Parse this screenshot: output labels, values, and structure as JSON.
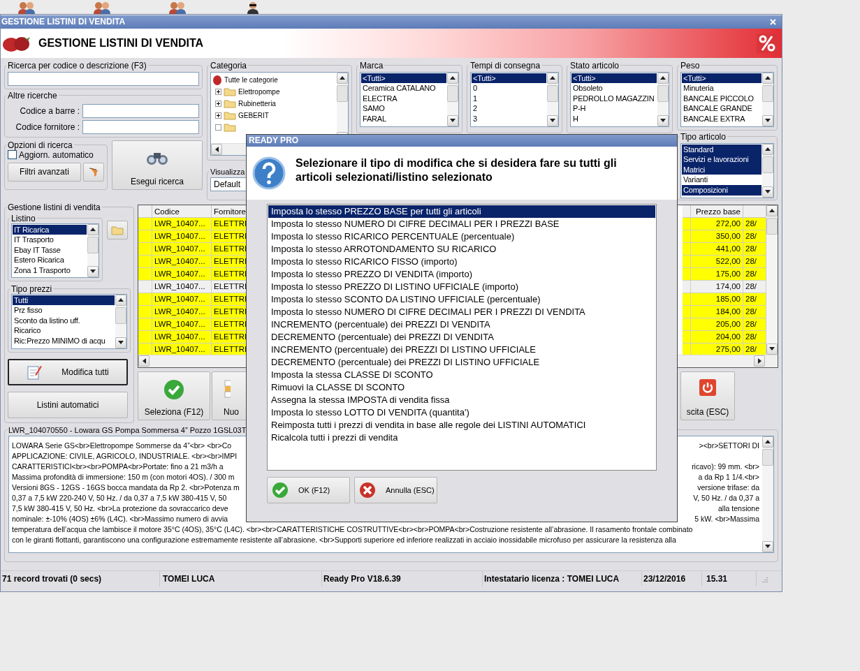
{
  "window": {
    "title": "GESTIONE LISTINI DI VENDITA"
  },
  "header": {
    "title": "GESTIONE LISTINI DI VENDITA"
  },
  "search": {
    "label": "Ricerca per codice o descrizione (F3)"
  },
  "other_searches": {
    "label": "Altre ricerche",
    "fields": [
      {
        "label": "Codice a barre :"
      },
      {
        "label": "Codice fornitore :"
      }
    ]
  },
  "search_options": {
    "label": "Opzioni di ricerca",
    "auto_update": {
      "label": "Aggiorn. automatico",
      "checked": false
    },
    "advanced_filters": "Filtri avanzati"
  },
  "run_search": "Esegui ricerca",
  "category": {
    "label": "Categoria",
    "root": "Tutte le categorie",
    "items": [
      {
        "label": "Elettropompe",
        "expanded": false
      },
      {
        "label": "Rubinetteria",
        "expanded": false
      },
      {
        "label": "GEBERIT",
        "expanded": false
      }
    ]
  },
  "view": {
    "label": "Visualizza",
    "value": "Default"
  },
  "filters": [
    {
      "label": "Marca",
      "items": [
        {
          "label": "<Tutti>",
          "selected": true
        },
        {
          "label": "Ceramica CATALANO",
          "selected": false
        },
        {
          "label": "ELECTRA",
          "selected": false
        },
        {
          "label": "SAMO",
          "selected": false
        },
        {
          "label": "FARAL",
          "selected": false
        }
      ]
    },
    {
      "label": "Tempi di consegna",
      "items": [
        {
          "label": "<Tutti>",
          "selected": true
        },
        {
          "label": "0",
          "selected": false
        },
        {
          "label": "1",
          "selected": false
        },
        {
          "label": "2",
          "selected": false
        },
        {
          "label": "3",
          "selected": false
        }
      ]
    },
    {
      "label": "Stato articolo",
      "items": [
        {
          "label": "<Tutti>",
          "selected": true
        },
        {
          "label": "Obsoleto",
          "selected": false
        },
        {
          "label": "PEDROLLO MAGAZZIN",
          "selected": false
        },
        {
          "label": "P-H",
          "selected": false
        },
        {
          "label": "H",
          "selected": false
        }
      ]
    },
    {
      "label": "Peso",
      "items": [
        {
          "label": "<Tutti>",
          "selected": true
        },
        {
          "label": "Minuteria",
          "selected": false
        },
        {
          "label": "BANCALE PICCOLO",
          "selected": false
        },
        {
          "label": "BANCALE GRANDE",
          "selected": false
        },
        {
          "label": "BANCALE EXTRA",
          "selected": false
        }
      ]
    }
  ],
  "item_type": {
    "label": "Tipo articolo",
    "items": [
      {
        "label": "Standard",
        "selected": true
      },
      {
        "label": "Servizi e lavorazioni",
        "selected": true
      },
      {
        "label": "Matrici",
        "selected": true
      },
      {
        "label": "Varianti",
        "selected": false
      },
      {
        "label": "Composizioni",
        "selected": true
      }
    ]
  },
  "price_lists": {
    "label": "Gestione listini di vendita",
    "list": {
      "label": "Listino",
      "items": [
        {
          "label": "IT Ricarica",
          "selected": true
        },
        {
          "label": "IT Trasporto",
          "selected": false
        },
        {
          "label": "Ebay IT Tasse",
          "selected": false
        },
        {
          "label": "Estero Ricarica",
          "selected": false
        },
        {
          "label": "Zona 1 Trasporto",
          "selected": false
        }
      ]
    },
    "price_type": {
      "label": "Tipo prezzi",
      "items": [
        {
          "label": "Tutti",
          "selected": true
        },
        {
          "label": "Prz fisso",
          "selected": false
        },
        {
          "label": "Sconto da listino uff.",
          "selected": false
        },
        {
          "label": "Ricarico",
          "selected": false
        },
        {
          "label": "Ric:Prezzo MINIMO di acqu",
          "selected": false
        }
      ]
    },
    "buttons": [
      {
        "label": "Modifica tutti",
        "kind": "edit",
        "focused": true
      },
      {
        "label": "Listini automatici",
        "kind": "plain",
        "focused": false
      }
    ]
  },
  "table": {
    "columns": [
      "Codice",
      "Fornitore",
      "Prezzo base"
    ],
    "rows": [
      {
        "code": "LWR_10407...",
        "supplier": "ELETTRI",
        "base_price": "272,00",
        "column_4": "28/",
        "highlight": true
      },
      {
        "code": "LWR_10407...",
        "supplier": "ELETTRI",
        "base_price": "350,00",
        "column_4": "28/",
        "highlight": true
      },
      {
        "code": "LWR_10407...",
        "supplier": "ELETTRI",
        "base_price": "441,00",
        "column_4": "28/",
        "highlight": true
      },
      {
        "code": "LWR_10407...",
        "supplier": "ELETTRI",
        "base_price": "522,00",
        "column_4": "28/",
        "highlight": true
      },
      {
        "code": "LWR_10407...",
        "supplier": "ELETTRI",
        "base_price": "175,00",
        "column_4": "28/",
        "highlight": true
      },
      {
        "code": "LWR_10407...",
        "supplier": "ELETTRI",
        "base_price": "174,00",
        "column_4": "28/",
        "highlight": false
      },
      {
        "code": "LWR_10407...",
        "supplier": "ELETTRI",
        "base_price": "185,00",
        "column_4": "28/",
        "highlight": true
      },
      {
        "code": "LWR_10407...",
        "supplier": "ELETTRI",
        "base_price": "184,00",
        "column_4": "28/",
        "highlight": true
      },
      {
        "code": "LWR_10407...",
        "supplier": "ELETTRI",
        "base_price": "205,00",
        "column_4": "28/",
        "highlight": true
      },
      {
        "code": "LWR_10407...",
        "supplier": "ELETTRI",
        "base_price": "204,00",
        "column_4": "28/",
        "highlight": true
      },
      {
        "code": "LWR_10407...",
        "supplier": "ELETTRI",
        "base_price": "275,00",
        "column_4": "28/",
        "highlight": true
      }
    ]
  },
  "actions": [
    {
      "label": "Seleziona (F12)",
      "kind": "select"
    },
    {
      "label": "Nuo",
      "kind": "new"
    },
    {
      "label": "scita (ESC)",
      "kind": "exit"
    }
  ],
  "description": {
    "title": "LWR_104070550 - Lowara GS Pompa Sommersa 4” Pozzo 1GSL03T",
    "lines": [
      {
        "left": "LOWARA Serie GS<br>Elettropompe Sommerse da 4”<br> <br>Co",
        "right": "><br>SETTORI DI"
      },
      {
        "left": "APPLICAZIONE: CIVILE, AGRICOLO, INDUSTRIALE. <br><br>IMPI"
      },
      {
        "left": "CARATTERISTICI<br><br>POMPA<br>Portate: fino a 21 m3/h a",
        "right": "ricavo): 99 mm. <br>"
      },
      {
        "left": "Massima profondità di immersione: 150 m (con motori 4OS). / 300 m",
        "right": "a da Rp 1 1/4.<br>"
      },
      {
        "left": "Versioni 8GS - 12GS - 16GS bocca mandata da Rp 2. <br>Potenza m",
        "right": "versione trifase: da"
      },
      {
        "left": "0,37 a 7,5 kW 220-240 V, 50 Hz. / da 0,37 a 7,5 kW 380-415 V, 50",
        "right": "V, 50 Hz. / da 0,37 a"
      },
      {
        "left": "7,5 kW 380-415 V, 50 Hz. <br>La protezione da sovraccarico deve",
        "right": "alla tensione"
      },
      {
        "left": "nominale: ±-10% (4OS) ±6% (L4C). <br>Massimo numero di avvia",
        "right": "5 kW. <br>Massima"
      },
      {
        "left": "temperatura dell’acqua che lambisce il motore 35°C (4OS), 35°C (L4C). <br><br>CARATTERISTICHE COSTRUTTIVE<br><br>POMPA<br>Costruzione resistente all’abrasione. Il rasamento frontale combinato"
      },
      {
        "left": "con le giranti flottanti, garantiscono una configurazione estremamente resistente all’abrasione. <br>Supporti superiore ed inferiore realizzati in acciaio inossidabile microfuso per assicurare la resistenza alla"
      }
    ]
  },
  "status_bar": [
    "71 record trovati (0 secs)",
    "TOMEI LUCA",
    "Ready Pro V18.6.39",
    "Intestatario licenza : TOMEI LUCA",
    "23/12/2016",
    "15.31"
  ],
  "dialog": {
    "title": "READY PRO",
    "message": "Selezionare il tipo di modifica che si desidera fare su tutti gli articoli selezionati/listino selezionato",
    "options": [
      {
        "label": "Imposta lo stesso PREZZO BASE per tutti gli articoli",
        "selected": true
      },
      {
        "label": "Imposta lo stesso NUMERO DI CIFRE DECIMALI PER I PREZZI BASE",
        "selected": false
      },
      {
        "label": "Imposta lo stesso RICARICO PERCENTUALE (percentuale)",
        "selected": false
      },
      {
        "label": "Imposta lo stesso ARROTONDAMENTO SU RICARICO",
        "selected": false
      },
      {
        "label": "Imposta lo stesso RICARICO FISSO (importo)",
        "selected": false
      },
      {
        "label": "Imposta lo stesso PREZZO DI VENDITA (importo)",
        "selected": false
      },
      {
        "label": "Imposta lo stesso PREZZO DI LISTINO UFFICIALE (importo)",
        "selected": false
      },
      {
        "label": "Imposta lo stesso SCONTO DA LISTINO UFFICIALE (percentuale)",
        "selected": false
      },
      {
        "label": "Imposta lo stesso NUMERO DI CIFRE DECIMALI PER I PREZZI DI VENDITA",
        "selected": false
      },
      {
        "label": "INCREMENTO (percentuale) dei PREZZI DI VENDITA",
        "selected": false
      },
      {
        "label": "DECREMENTO (percentuale) dei PREZZI DI VENDITA",
        "selected": false
      },
      {
        "label": "INCREMENTO (percentuale) dei PREZZI DI LISTINO UFFICIALE",
        "selected": false
      },
      {
        "label": "DECREMENTO (percentuale) dei PREZZI DI LISTINO UFFICIALE",
        "selected": false
      },
      {
        "label": "Imposta la stessa CLASSE DI SCONTO",
        "selected": false
      },
      {
        "label": "Rimuovi la CLASSE DI SCONTO",
        "selected": false
      },
      {
        "label": "Assegna la stessa IMPOSTA di vendita fissa",
        "selected": false
      },
      {
        "label": "Imposta lo stesso LOTTO DI VENDITA (quantita')",
        "selected": false
      },
      {
        "label": "Reimposta tutti i prezzi di vendita in base alle regole dei LISTINI AUTOMATICI",
        "selected": false
      },
      {
        "label": "Ricalcola tutti i prezzi di vendita",
        "selected": false
      }
    ],
    "buttons": [
      {
        "label": "OK (F12)",
        "kind": "ok"
      },
      {
        "label": "Annulla (ESC)",
        "kind": "cancel"
      }
    ]
  }
}
